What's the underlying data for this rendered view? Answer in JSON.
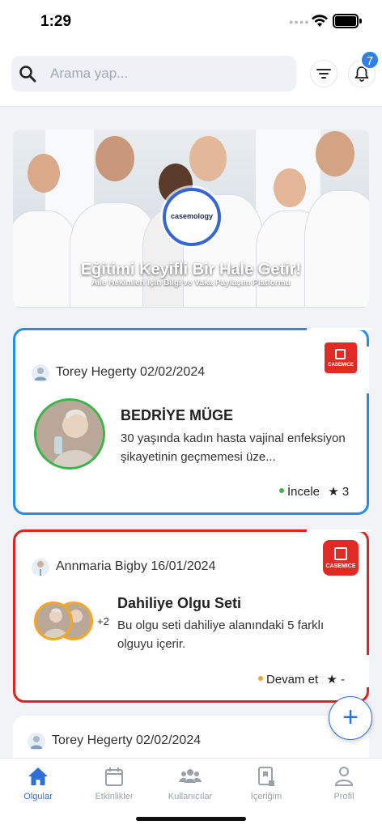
{
  "status_bar": {
    "time": "1:29"
  },
  "search": {
    "placeholder": "Arama yap..."
  },
  "notifications": {
    "count": "7"
  },
  "banner": {
    "logo_text": "casemology",
    "title": "Eğitimi Keyifli Bir Hale Getir!",
    "subtitle": "Aile Hekimleri İçin Bilgi ve Vaka Paylaşım Platformu"
  },
  "cards": [
    {
      "author": "Torey Hegerty 02/02/2024",
      "logo_label": "CASEMICE",
      "title": "BEDRİYE MÜGE",
      "description": "30 yaşında kadın hasta vajinal enfeksiyon şikayetinin geçmemesi üze...",
      "action": "İncele",
      "rating": "3",
      "status_color": "#3bb54a",
      "border_color": "#1f8ef1"
    },
    {
      "author": "Annmaria Bigby 16/01/2024",
      "logo_label": "CASEMICE",
      "title": "Dahiliye Olgu Seti",
      "extra_count": "+2",
      "description": "Bu olgu seti dahiliye alanındaki 5 farklı olguyu içerir.",
      "action": "Devam et",
      "rating": "-",
      "status_color": "#f5a623",
      "border_color": "#e5211f"
    },
    {
      "author": "Torey Hegerty 02/02/2024"
    }
  ],
  "fab": {
    "label": "+"
  },
  "tabs": [
    {
      "label": "Olgular",
      "icon": "home-icon",
      "active": true
    },
    {
      "label": "Etkinlikler",
      "icon": "calendar-icon",
      "active": false
    },
    {
      "label": "Kullanıcılar",
      "icon": "users-icon",
      "active": false
    },
    {
      "label": "İçeriğim",
      "icon": "book-icon",
      "active": false
    },
    {
      "label": "Profil",
      "icon": "person-icon",
      "active": false
    }
  ],
  "colors": {
    "accent": "#2f6fd6",
    "badge": "#2f80ed",
    "case_red": "#e02a24"
  }
}
